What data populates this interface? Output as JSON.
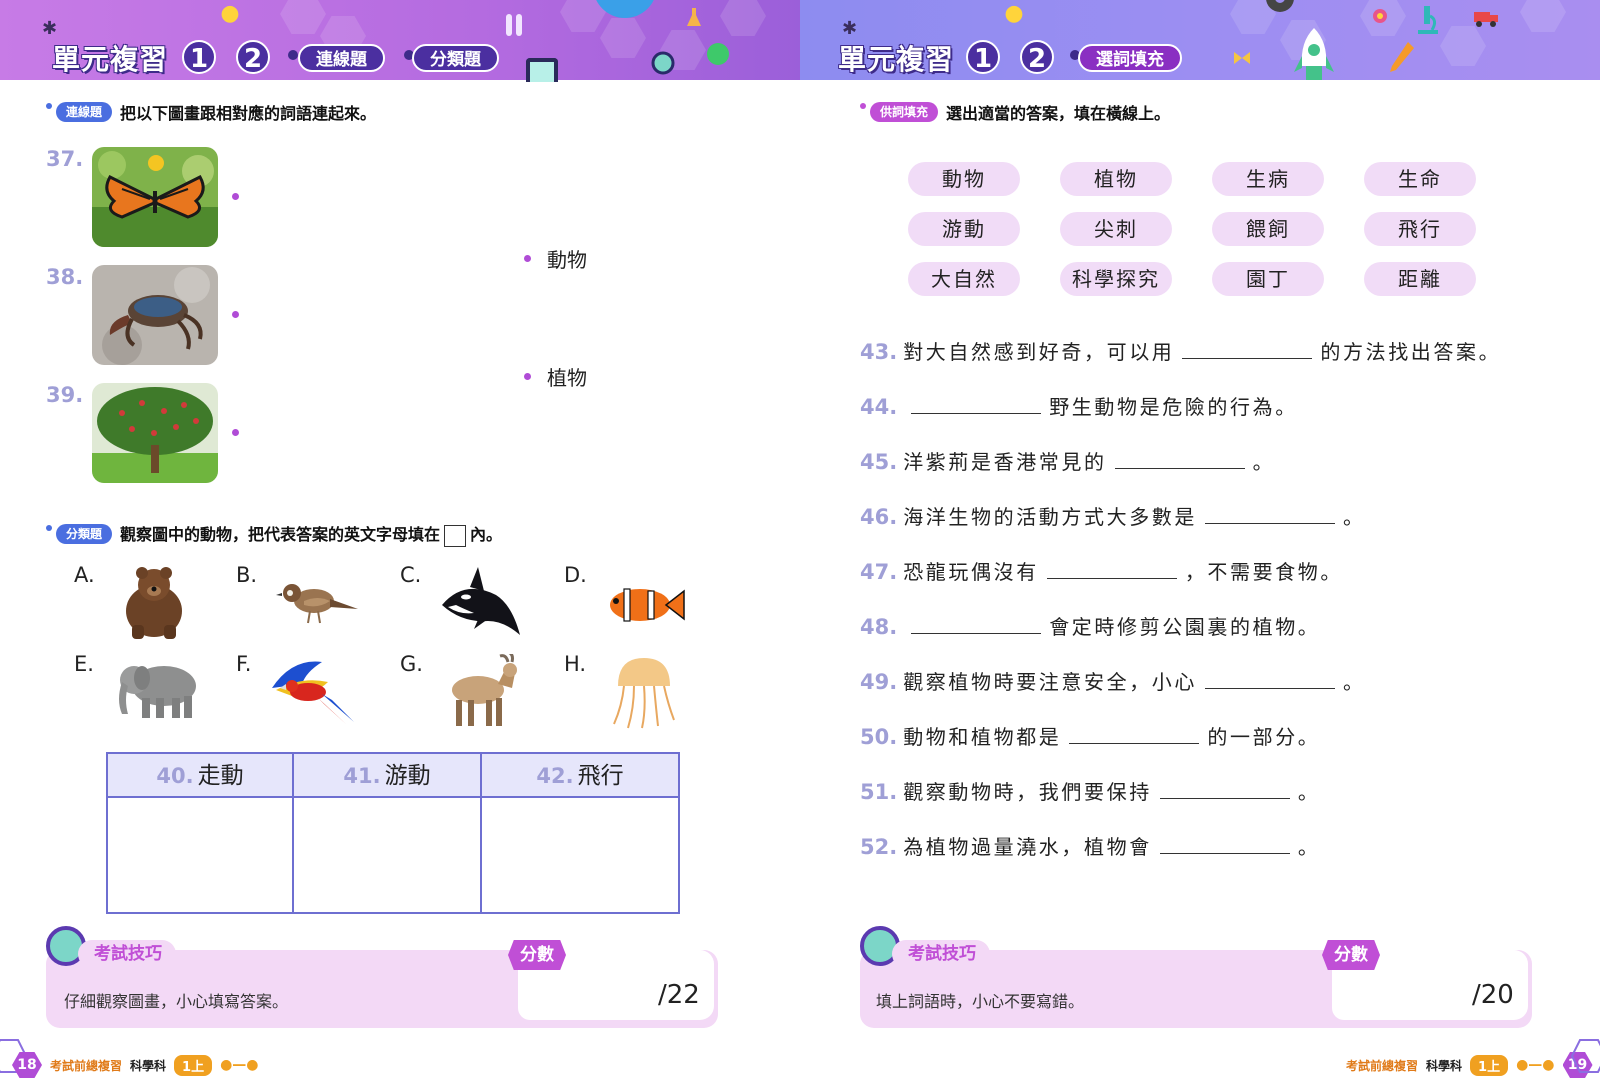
{
  "left_page": {
    "header": {
      "title": "單元複習",
      "unit_numbers": [
        "1",
        "2"
      ],
      "tags": [
        "連線題",
        "分類題"
      ]
    },
    "matching": {
      "section_tag": "連線題",
      "instruction": "把以下圖畫跟相對應的詞語連起來。",
      "items": [
        {
          "number": "37.",
          "image": "butterfly-photo"
        },
        {
          "number": "38.",
          "image": "crab-photo"
        },
        {
          "number": "39.",
          "image": "tree-photo"
        }
      ],
      "options": [
        "動物",
        "植物"
      ]
    },
    "classify": {
      "section_tag": "分類題",
      "instruction_before": "觀察圖中的動物，把代表答案的英文字母填在",
      "instruction_after": "內。",
      "animals": [
        {
          "letter": "A.",
          "icon": "bear-icon"
        },
        {
          "letter": "B.",
          "icon": "sparrow-icon"
        },
        {
          "letter": "C.",
          "icon": "orca-icon"
        },
        {
          "letter": "D.",
          "icon": "clownfish-icon"
        },
        {
          "letter": "E.",
          "icon": "elephant-icon"
        },
        {
          "letter": "F.",
          "icon": "parrot-icon"
        },
        {
          "letter": "G.",
          "icon": "goat-icon"
        },
        {
          "letter": "H.",
          "icon": "jellyfish-icon"
        }
      ],
      "table_headers": [
        {
          "number": "40.",
          "label": "走動"
        },
        {
          "number": "41.",
          "label": "游動"
        },
        {
          "number": "42.",
          "label": "飛行"
        }
      ]
    },
    "tips": {
      "label": "考試技巧",
      "text": "仔細觀察圖畫，小心填寫答案。",
      "score_label": "分數",
      "score": "/22"
    },
    "footer": {
      "page_number": "18",
      "book": "考試前總複習",
      "subject": "科學科",
      "grade": "1上"
    }
  },
  "right_page": {
    "header": {
      "title": "單元複習",
      "unit_numbers": [
        "1",
        "2"
      ],
      "tags": [
        "選詞填充"
      ]
    },
    "word_fill": {
      "section_tag": "供詞填充",
      "instruction": "選出適當的答案，填在橫線上。",
      "word_bank": [
        "動物",
        "植物",
        "生病",
        "生命",
        "游動",
        "尖刺",
        "餵飼",
        "飛行",
        "大自然",
        "科學探究",
        "園丁",
        "距離"
      ],
      "questions": [
        {
          "number": "43.",
          "before": "對大自然感到好奇，可以用",
          "after": "的方法找出答案。"
        },
        {
          "number": "44.",
          "before": "",
          "after": "野生動物是危險的行為。"
        },
        {
          "number": "45.",
          "before": "洋紫荊是香港常見的",
          "after": "。"
        },
        {
          "number": "46.",
          "before": "海洋生物的活動方式大多數是",
          "after": "。"
        },
        {
          "number": "47.",
          "before": "恐龍玩偶沒有",
          "after": "，不需要食物。"
        },
        {
          "number": "48.",
          "before": "",
          "after": "會定時修剪公園裏的植物。"
        },
        {
          "number": "49.",
          "before": "觀察植物時要注意安全，小心",
          "after": "。"
        },
        {
          "number": "50.",
          "before": "動物和植物都是",
          "after": "的一部分。"
        },
        {
          "number": "51.",
          "before": "觀察動物時，我們要保持",
          "after": "。"
        },
        {
          "number": "52.",
          "before": "為植物過量澆水，植物會",
          "after": "。"
        }
      ]
    },
    "tips": {
      "label": "考試技巧",
      "text": "填上詞語時，小心不要寫錯。",
      "score_label": "分數",
      "score": "/20"
    },
    "footer": {
      "page_number": "19",
      "book": "考試前總複習",
      "subject": "科學科",
      "grade": "1上"
    }
  },
  "colors": {
    "left_band": "#b46be0",
    "right_band": "#9c8ef2",
    "question_number": "#9f9fd6",
    "accent_purple": "#4b2fa0",
    "accent_pink": "#c04fd6",
    "table_border": "#6e6fd1",
    "word_bank_bg": "#f1dcf7",
    "tips_bg": "#f3d9f6"
  }
}
